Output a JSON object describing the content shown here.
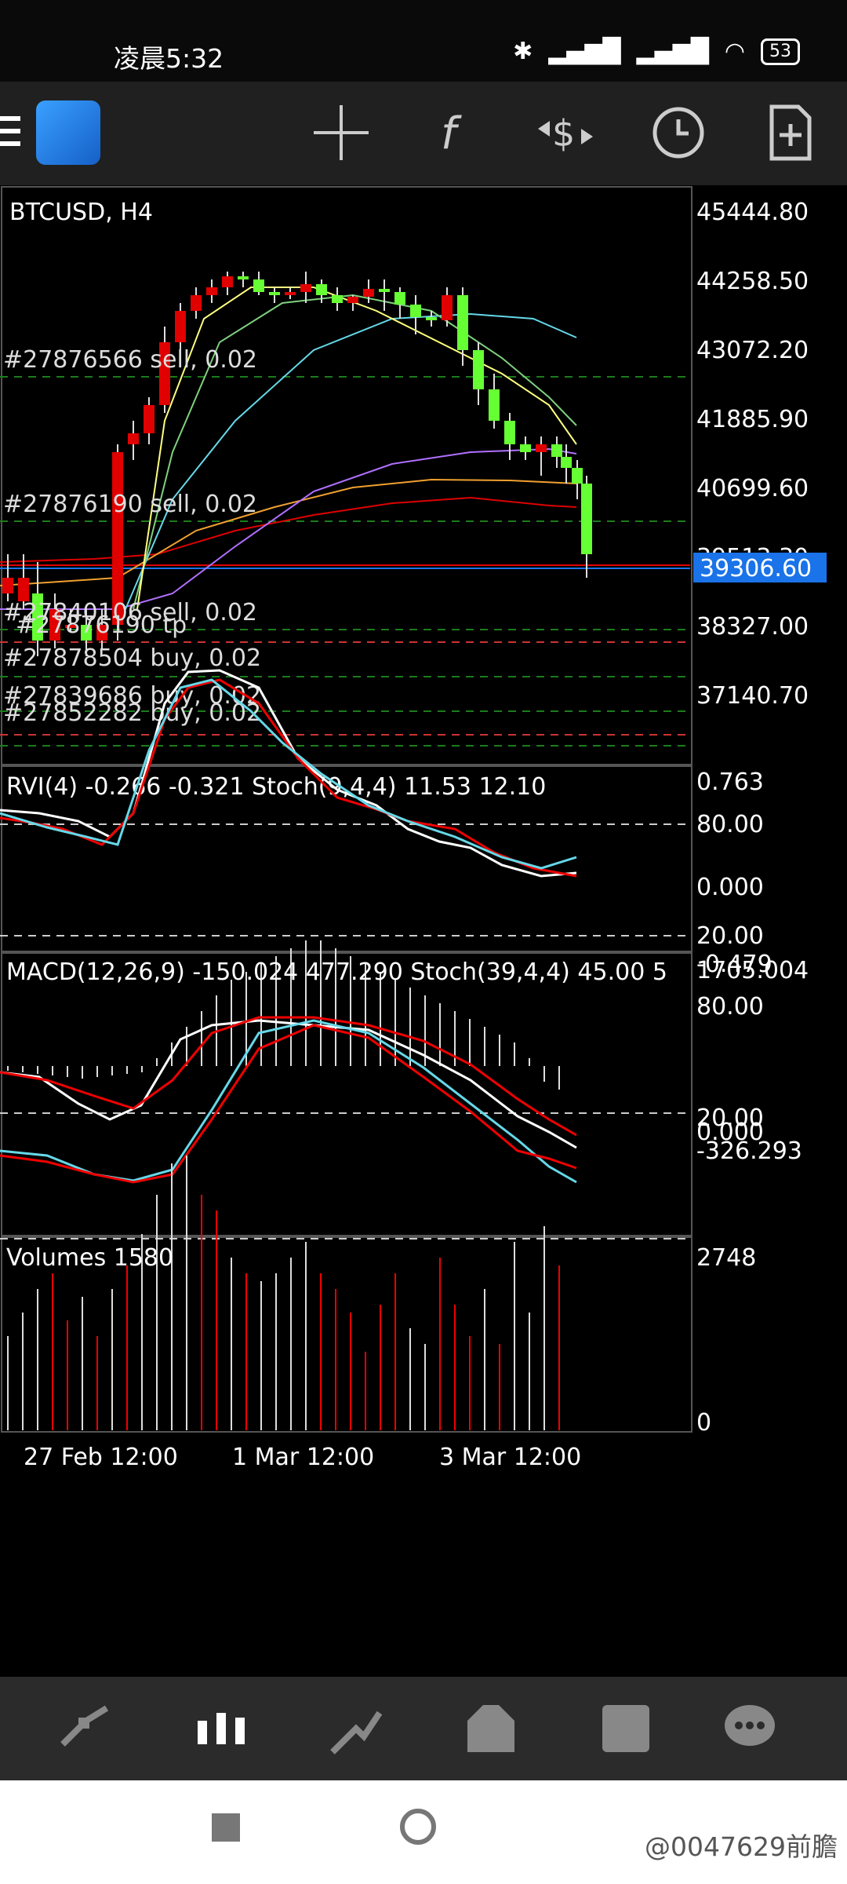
{
  "status": {
    "time": "凌晨5:32",
    "battery": "53"
  },
  "toolbar": {
    "crosshair_icon": "crosshair-icon",
    "indicators_icon": "function-icon",
    "trade_icon": "dollar-arrows-icon",
    "period_icon": "clock-icon",
    "new_order_icon": "document-plus-icon"
  },
  "chart": {
    "symbol_label": "BTCUSD, H4",
    "price_labels": [
      "45444.80",
      "44258.50",
      "43072.20",
      "41885.90",
      "40699.60",
      "39513.30",
      "38327.00",
      "37140.70"
    ],
    "current_price": "39306.60",
    "orders": [
      "#27876566 sell, 0.02",
      "#27876190 sell, 0.02",
      "#27840106 sell, 0.02",
      "#27876190 tp",
      "#27878504 buy, 0.02",
      "#27839686 buy, 0.02",
      "#27852282 buy, 0.02"
    ],
    "rvi_label": "RVI(4) -0.266 -0.321 Stoch(9,4,4) 11.53 12.10",
    "rvi_axis": [
      "0.763",
      "80.00",
      "0.000",
      "20.00",
      "-0.479"
    ],
    "macd_label": "MACD(12,26,9) -150.024 477.290 Stoch(39,4,4) 45.00 5",
    "macd_axis": [
      "1705.004",
      "80.00",
      "20.00",
      "0.000",
      "-326.293"
    ],
    "volumes_label": "Volumes 1580",
    "volumes_axis": [
      "2748",
      "0"
    ],
    "time_labels": [
      "27 Feb 12:00",
      "1 Mar 12:00",
      "3 Mar 12:00"
    ],
    "colors": {
      "bull": "#66ff33",
      "bear": "#e00000",
      "current": "#1a73e8"
    }
  },
  "bottom_nav": {
    "items": [
      "quotes-icon",
      "chart-icon",
      "trade-icon",
      "history-icon",
      "news-icon",
      "chat-icon"
    ]
  },
  "watermark": "@0047629前膽"
}
